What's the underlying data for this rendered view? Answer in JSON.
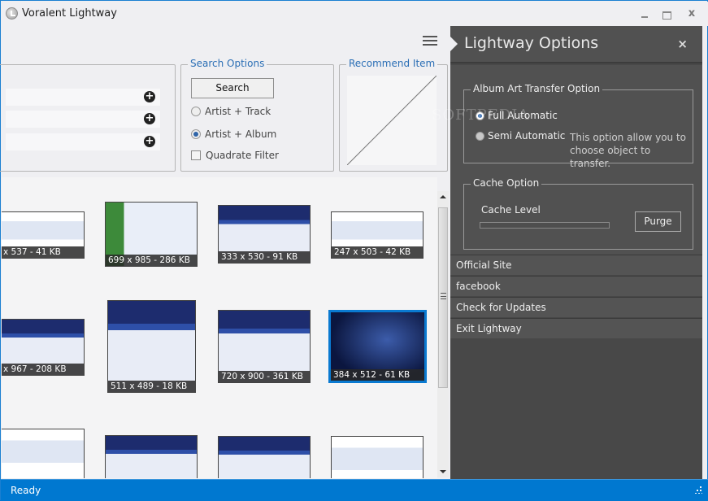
{
  "window": {
    "title": "Voralent Lightway",
    "controls": [
      "minimize",
      "maximize",
      "close"
    ],
    "close_glyph": "x"
  },
  "search_entries": [
    {
      "value": "",
      "add_icon": "plus-circle-icon"
    },
    {
      "value": "",
      "add_icon": "plus-circle-icon"
    },
    {
      "value": "",
      "add_icon": "plus-circle-icon"
    }
  ],
  "search_options": {
    "legend": "Search Options",
    "search_button": "Search",
    "radio_artist_track": "Artist + Track",
    "radio_artist_album": "Artist + Album",
    "selected_radio": "Artist + Album",
    "checkbox_quadrate": "Quadrate Filter",
    "quadrate_checked": false
  },
  "recommend": {
    "legend": "Recommend Item"
  },
  "gallery": {
    "thumbnails": [
      {
        "caption": "x 537 - 41 KB",
        "style": "ss-white"
      },
      {
        "caption": "699 x 985 - 286 KB",
        "style": "ss-green"
      },
      {
        "caption": "333 x 530 - 91 KB",
        "style": "ss-blue"
      },
      {
        "caption": "247 x 503 - 42 KB",
        "style": "ss-white"
      },
      {
        "caption": "x 967 - 208 KB",
        "style": "ss-blue"
      },
      {
        "caption": "511 x 489 - 18 KB",
        "style": "ss-blue"
      },
      {
        "caption": "720 x 900 - 361 KB",
        "style": "ss-blue"
      },
      {
        "caption": "384 x 512 - 61 KB",
        "style": "ss-dark",
        "selected": true
      },
      {
        "caption": "",
        "style": "ss-white"
      },
      {
        "caption": "",
        "style": "ss-blue"
      },
      {
        "caption": "",
        "style": "ss-blue"
      },
      {
        "caption": "",
        "style": "ss-white"
      }
    ]
  },
  "options_panel": {
    "title": "Lightway Options",
    "close_glyph": "×",
    "transfer": {
      "legend": "Album Art Transfer Option",
      "radio_full": "Full Automatic",
      "radio_semi": "Semi Automatic",
      "selected": "Full Automatic",
      "help": "This option allow you to choose object to transfer."
    },
    "cache": {
      "legend": "Cache Option",
      "label": "Cache Level",
      "level_percent": 0,
      "purge_button": "Purge"
    },
    "menu": [
      "Official Site",
      "facebook",
      "Check for Updates",
      "Exit Lightway"
    ]
  },
  "status": {
    "text": "Ready"
  },
  "watermark": "SOFTPEDIA"
}
